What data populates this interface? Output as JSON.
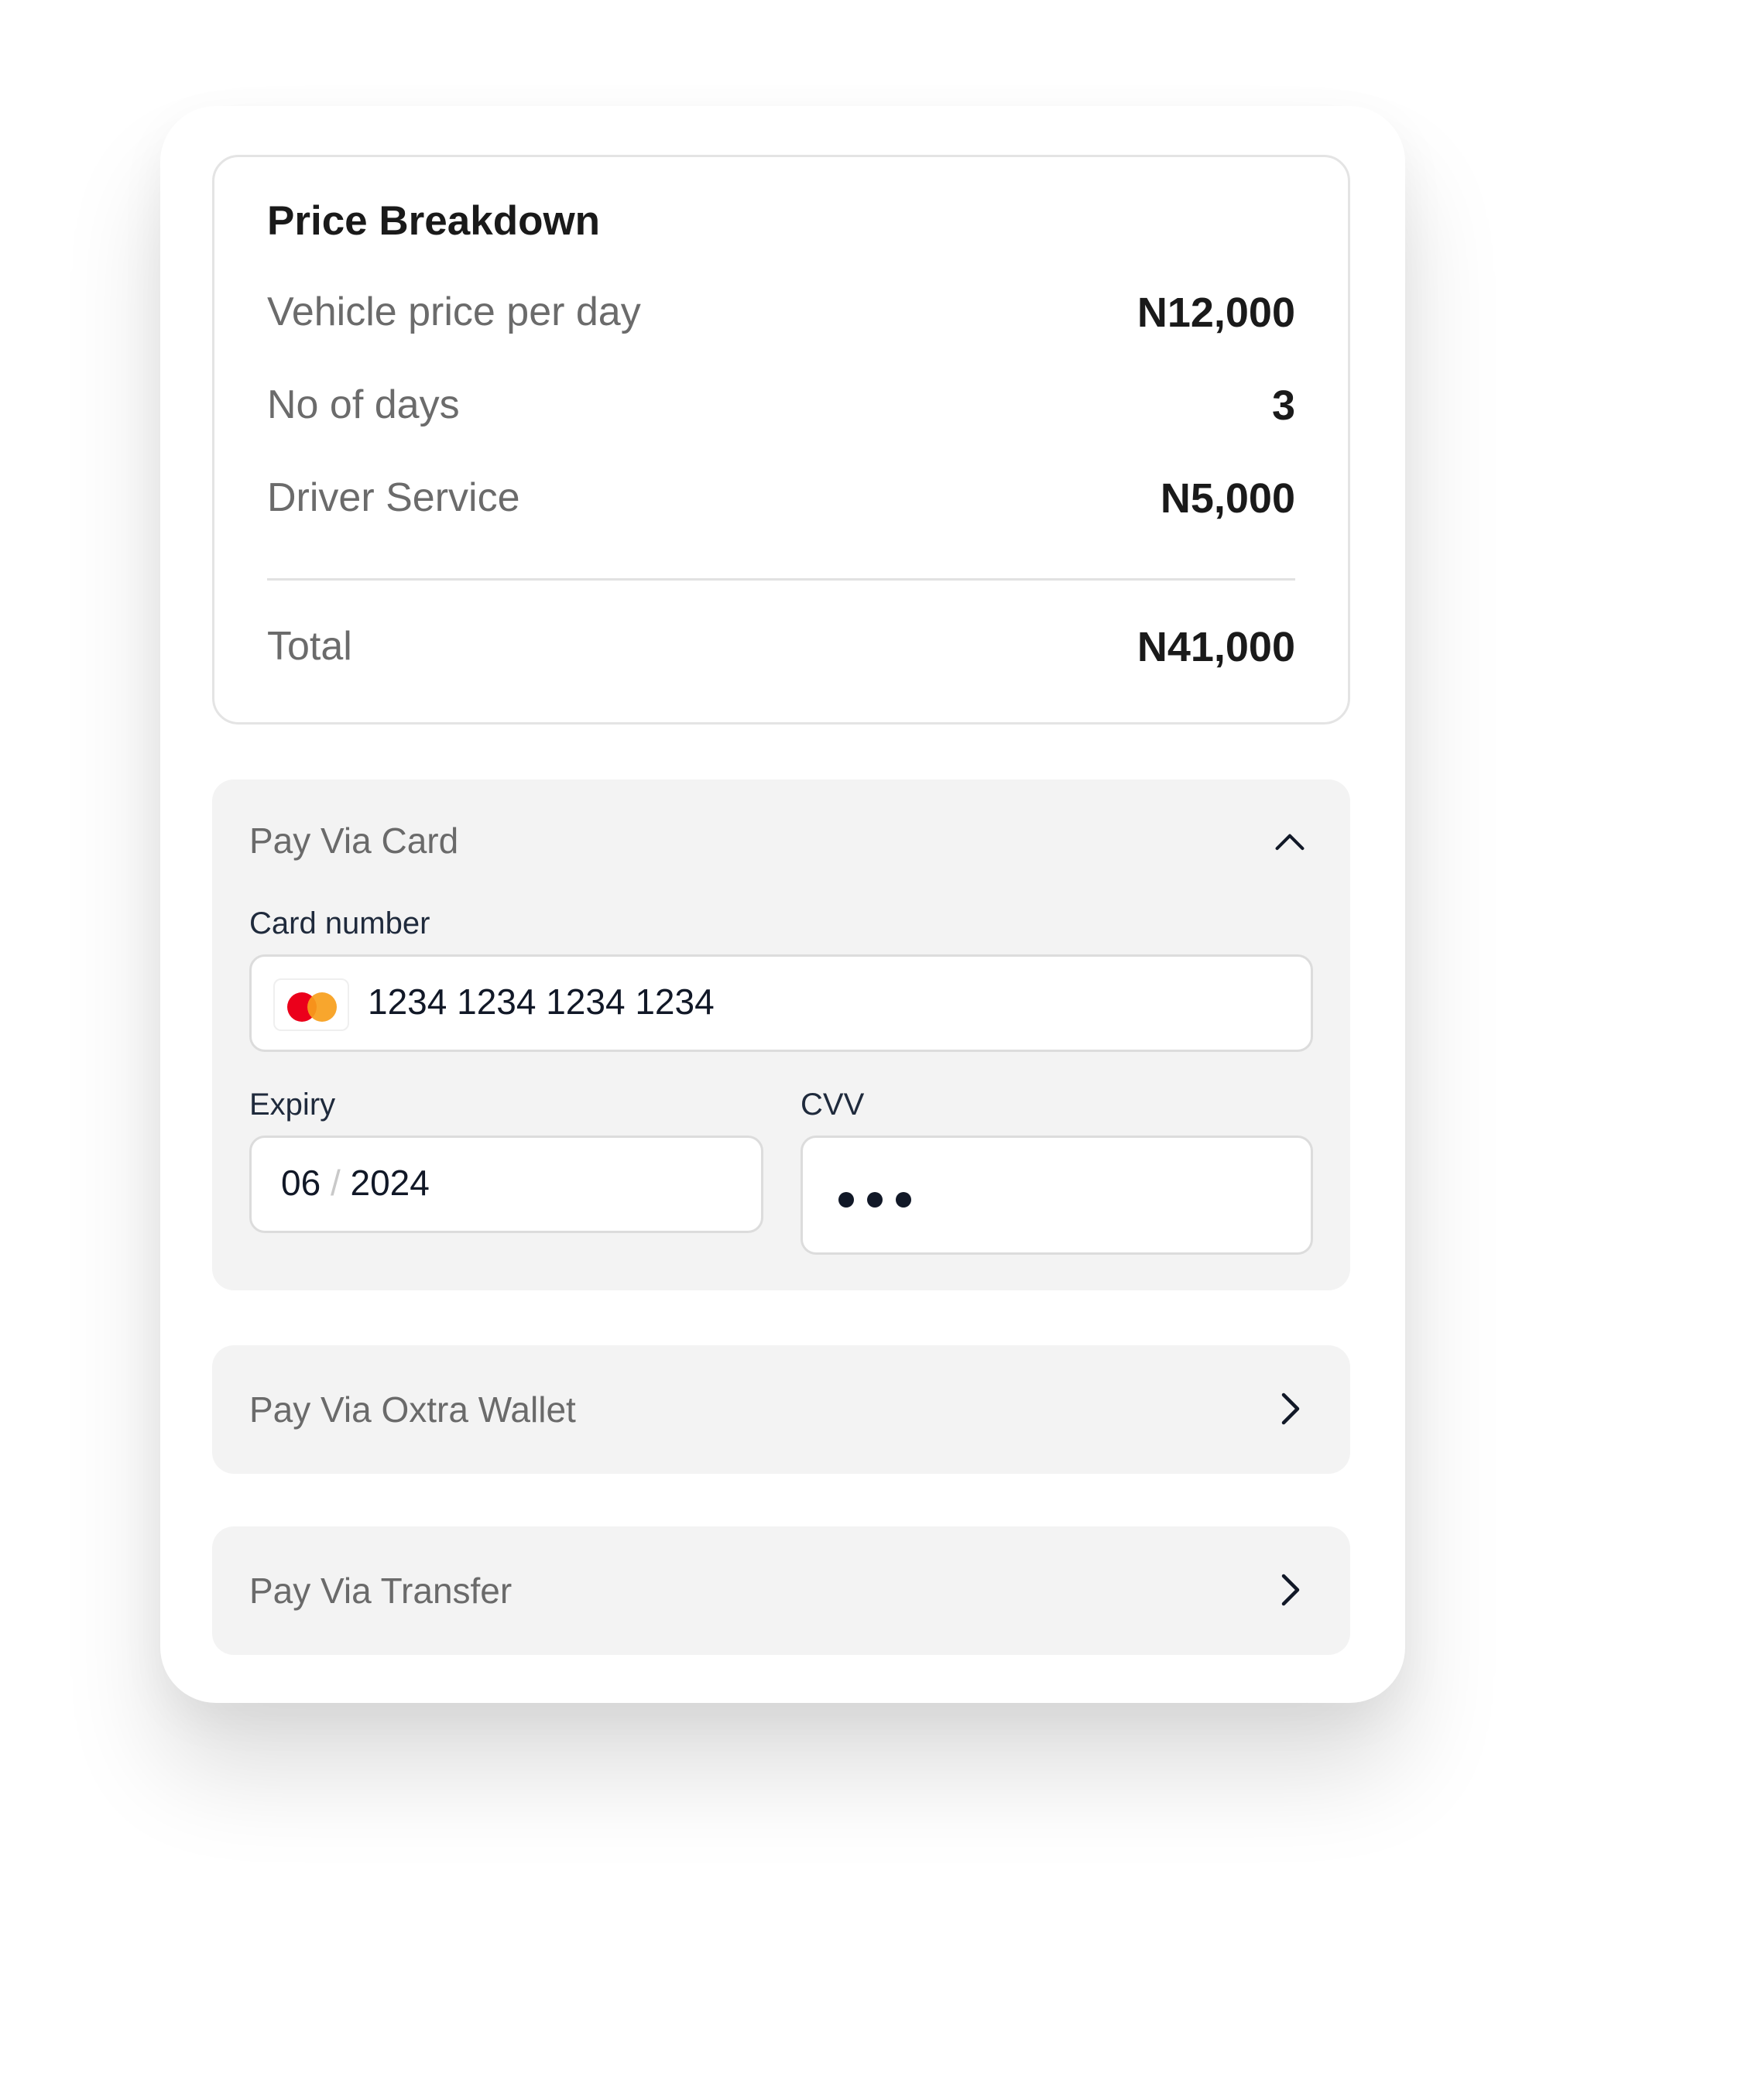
{
  "breakdown": {
    "title": "Price Breakdown",
    "rows": [
      {
        "label": "Vehicle price per day",
        "value": "N12,000"
      },
      {
        "label": "No of days",
        "value": "3"
      },
      {
        "label": "Driver Service",
        "value": "N5,000"
      }
    ],
    "total": {
      "label": "Total",
      "value": "N41,000"
    }
  },
  "pay_card": {
    "title": "Pay Via Card",
    "expanded": true,
    "card_number": {
      "label": "Card number",
      "value": "1234 1234 1234 1234",
      "brand_icon": "mastercard-icon"
    },
    "expiry": {
      "label": "Expiry",
      "month": "06",
      "separator": "/",
      "year": "2024"
    },
    "cvv": {
      "label": "CVV",
      "masked_length": 3
    }
  },
  "other_methods": [
    {
      "label": "Pay Via Oxtra Wallet",
      "icon": "chevron-right-icon"
    },
    {
      "label": "Pay Via Transfer",
      "icon": "chevron-right-icon"
    }
  ],
  "colors": {
    "mastercard_red": "#eb001b",
    "mastercard_orange": "#f79e1b",
    "panel_bg": "#f3f3f3",
    "text_dark": "#1a1a1a",
    "text_muted": "#6b6b6b"
  }
}
